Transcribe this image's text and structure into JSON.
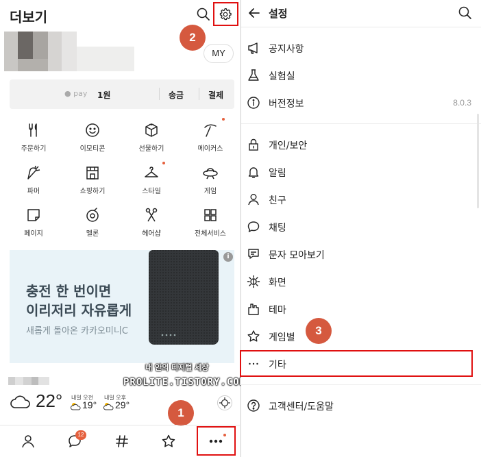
{
  "left": {
    "title": "더보기",
    "my_label": "MY",
    "pay": {
      "logo": "● pay",
      "amount": "1원",
      "send": "송금",
      "pay": "결제"
    },
    "grid": [
      {
        "label": "주문하기",
        "icon": "fork-knife-icon"
      },
      {
        "label": "이모티콘",
        "icon": "smiley-icon"
      },
      {
        "label": "선물하기",
        "icon": "gift-icon"
      },
      {
        "label": "메이커스",
        "icon": "pickaxe-icon"
      },
      {
        "label": "파머",
        "icon": "carrot-icon"
      },
      {
        "label": "쇼핑하기",
        "icon": "store-icon"
      },
      {
        "label": "스타일",
        "icon": "hanger-icon"
      },
      {
        "label": "게임",
        "icon": "ufo-icon"
      },
      {
        "label": "페이지",
        "icon": "page-icon"
      },
      {
        "label": "멜론",
        "icon": "melon-icon"
      },
      {
        "label": "헤어샵",
        "icon": "scissors-icon"
      },
      {
        "label": "전체서비스",
        "icon": "grid-icon"
      }
    ],
    "ad": {
      "line1": "충전 한 번이면",
      "line2": "이리저리 자유롭게",
      "line3": "새롭게 돌아온 카카오미니C",
      "info": "i"
    },
    "weather": {
      "temp": "22°",
      "tomorrow_am_label": "내일 오전",
      "tomorrow_am": "19°",
      "tomorrow_pm_label": "내일 오후",
      "tomorrow_pm": "29°"
    },
    "watermark": {
      "line1": "내 안의 디지털 세상",
      "line2": "PROLITE.TISTORY.COM"
    },
    "chat_badge": "12"
  },
  "steps": {
    "one": "1",
    "two": "2",
    "three": "3"
  },
  "right": {
    "title": "설정",
    "items": [
      {
        "label": "공지사항",
        "icon": "megaphone-icon",
        "value": ""
      },
      {
        "label": "실험실",
        "icon": "flask-icon",
        "value": ""
      },
      {
        "label": "버전정보",
        "icon": "info-icon",
        "value": "8.0.3"
      },
      {
        "label": "개인/보안",
        "icon": "lock-icon",
        "value": ""
      },
      {
        "label": "알림",
        "icon": "bell-icon",
        "value": ""
      },
      {
        "label": "친구",
        "icon": "person-icon",
        "value": ""
      },
      {
        "label": "채팅",
        "icon": "chat-bubble-icon",
        "value": ""
      },
      {
        "label": "문자 모아보기",
        "icon": "sms-icon",
        "value": ""
      },
      {
        "label": "화면",
        "icon": "brightness-icon",
        "value": ""
      },
      {
        "label": "테마",
        "icon": "theme-icon",
        "value": ""
      },
      {
        "label": "게임별",
        "icon": "star-icon",
        "value": ""
      },
      {
        "label": "기타",
        "icon": "more-dots-icon",
        "value": ""
      },
      {
        "label": "고객센터/도움말",
        "icon": "help-icon",
        "value": ""
      }
    ]
  },
  "colors": {
    "highlight": "#e01010",
    "step_badge": "#d5593f",
    "accent_dot": "#e5603e"
  }
}
